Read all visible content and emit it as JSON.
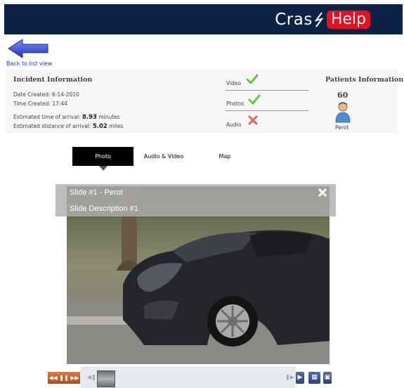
{
  "header": {
    "logo_part1": "Cras",
    "logo_part2": "Help",
    "bg_color": "#0d2345",
    "accent_color": "#e8101f"
  },
  "nav": {
    "back_label": "Back to list view"
  },
  "incident": {
    "title": "Incident Information",
    "date_label": "Date Created:",
    "date_value": "6-14-2010",
    "time_label": "Time Created:",
    "time_value": "17:44",
    "eta_label": "Estimated time of arrival:",
    "eta_value": "8.93",
    "eta_unit": "minutes",
    "distance_label": "Estimated distance of arrival:",
    "distance_value": "5.02",
    "distance_unit": "miles"
  },
  "media": {
    "items": [
      {
        "label": "Video",
        "status": "available",
        "icon": "check-icon"
      },
      {
        "label": "Photos",
        "status": "available",
        "icon": "check-icon"
      },
      {
        "label": "Audio",
        "status": "unavailable",
        "icon": "cross-icon"
      }
    ]
  },
  "patients": {
    "title": "Patients Information",
    "age": "60",
    "name": "Perot"
  },
  "tabs": [
    {
      "label": "Photo",
      "active": true
    },
    {
      "label": "Audio & Video",
      "active": false
    },
    {
      "label": "Map",
      "active": false
    }
  ],
  "slide": {
    "title": "Slide #1 - Perot",
    "description": "Slide Description #1",
    "close_label": "X"
  }
}
